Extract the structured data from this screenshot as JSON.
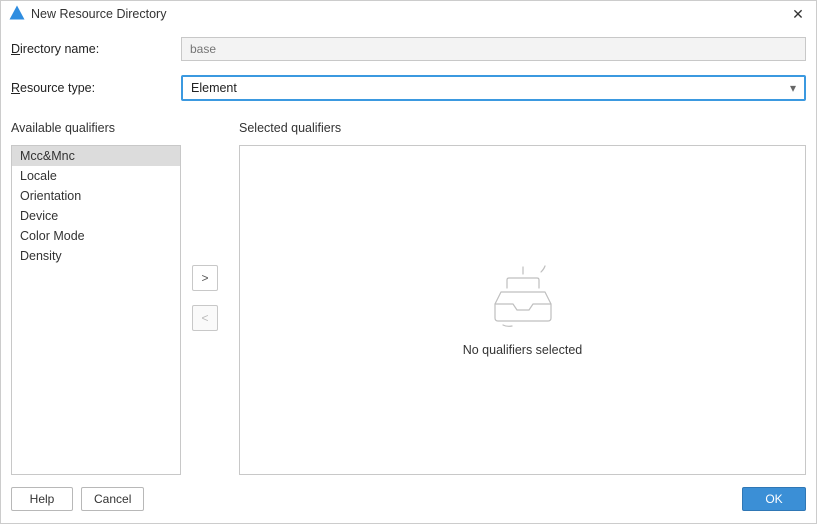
{
  "titlebar": {
    "title": "New Resource Directory"
  },
  "form": {
    "dir_label_prefix": "D",
    "dir_label_rest": "irectory name:",
    "dir_placeholder": "base",
    "type_label_prefix": "R",
    "type_label_rest": "esource type:",
    "type_value": "Element"
  },
  "qualifiers": {
    "available_label": "Available qualifiers",
    "selected_label": "Selected qualifiers",
    "items": [
      {
        "label": "Mcc&Mnc",
        "selected": true
      },
      {
        "label": "Locale",
        "selected": false
      },
      {
        "label": "Orientation",
        "selected": false
      },
      {
        "label": "Device",
        "selected": false
      },
      {
        "label": "Color Mode",
        "selected": false
      },
      {
        "label": "Density",
        "selected": false
      }
    ],
    "arrow_right": ">",
    "arrow_left": "<",
    "empty_text": "No qualifiers selected"
  },
  "footer": {
    "help": "Help",
    "cancel": "Cancel",
    "ok": "OK"
  }
}
